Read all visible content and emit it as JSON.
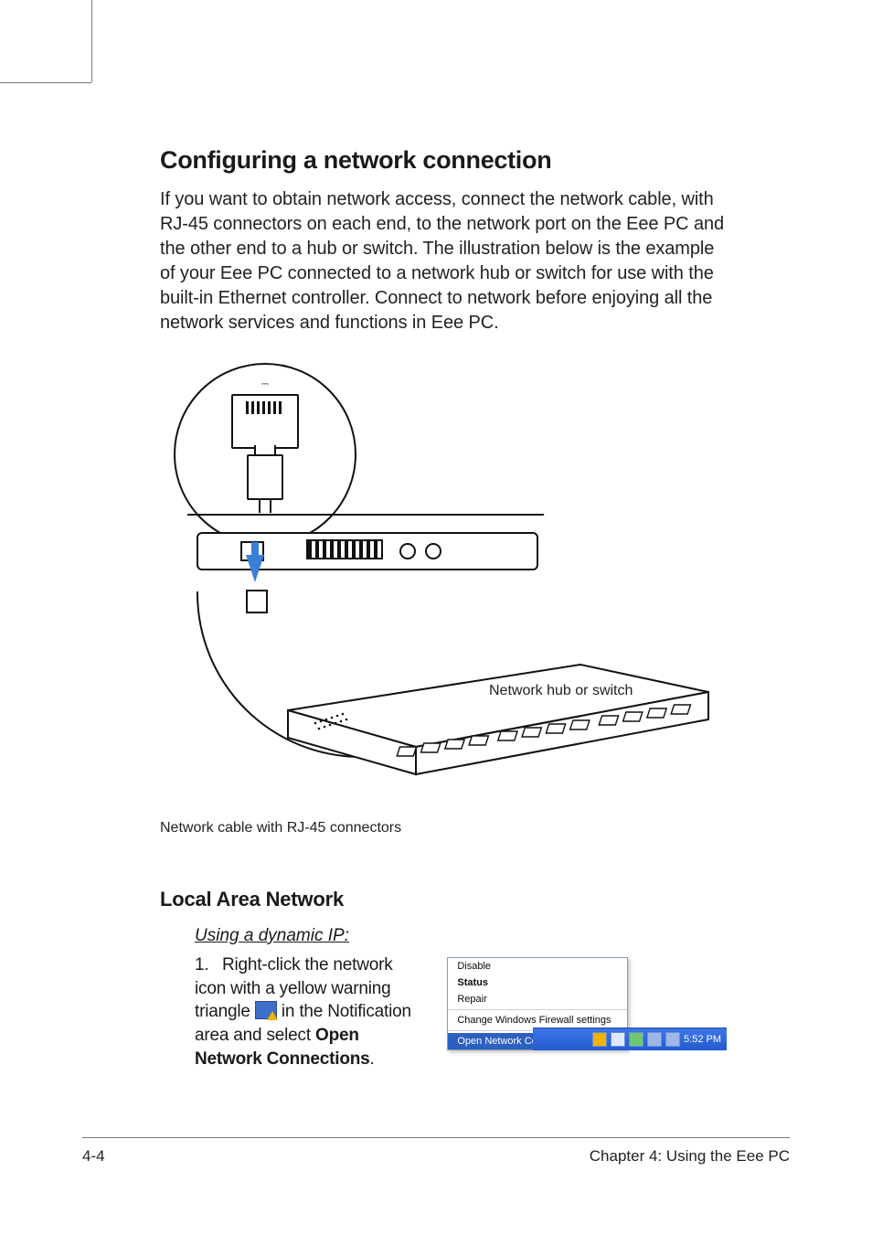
{
  "heading": "Configuring a network connection",
  "intro": "If you want to obtain network access, connect the network cable, with RJ-45 connectors on each end, to the network port on the Eee PC and the other end to a hub or switch. The illustration below is the example of your Eee PC connected to a network hub or switch for use with the built-in Ethernet controller. Connect to network before enjoying all the network services and functions in Eee PC.",
  "figure": {
    "switch_label": "Network hub or switch",
    "caption": "Network cable with RJ-45 connectors"
  },
  "subheading": "Local Area Network",
  "subheading2": "Using a dynamic IP:",
  "step1": {
    "number": "1.",
    "pre": "Right-click the network icon with a yellow warning triangle ",
    "mid": " in the Notification area and select ",
    "bold": "Open Network Connections",
    "post": "."
  },
  "context_menu": {
    "items": [
      {
        "label": "Disable",
        "bold": false
      },
      {
        "label": "Status",
        "bold": true
      },
      {
        "label": "Repair",
        "bold": false
      }
    ],
    "sep_item": "Change Windows Firewall settings",
    "selected": "Open Network Connections"
  },
  "taskbar": {
    "time": "5:52 PM"
  },
  "footer": {
    "left": "4-4",
    "right": "Chapter 4: Using the Eee PC"
  }
}
